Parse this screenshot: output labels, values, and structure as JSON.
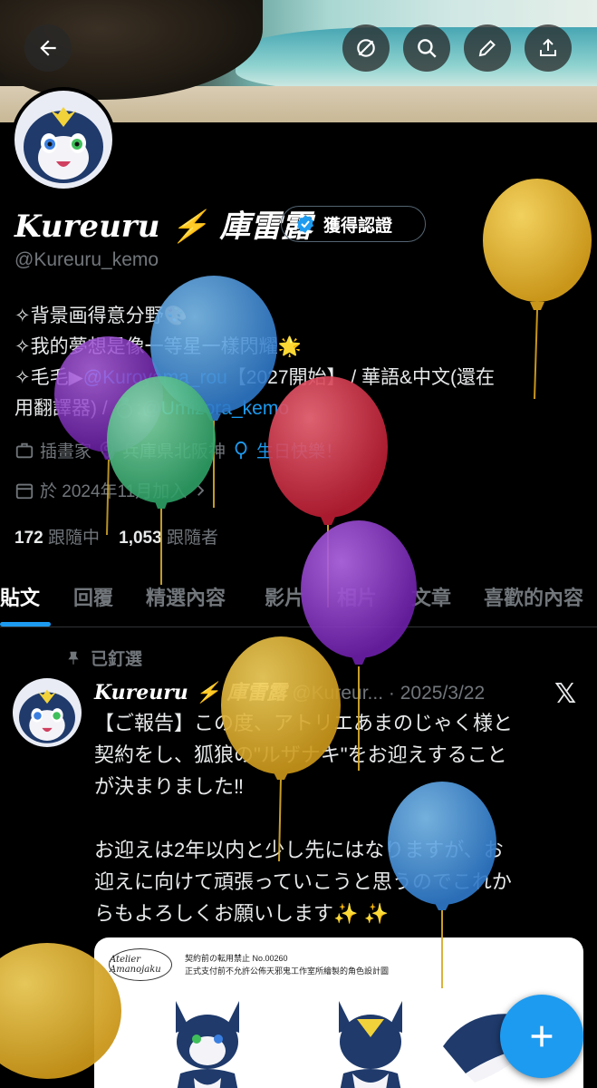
{
  "header": {
    "back_icon": "arrow-left-icon",
    "action_icons": [
      "eye-slash-icon",
      "search-icon",
      "pencil-icon",
      "share-icon"
    ]
  },
  "profile": {
    "display_name": "Kureuru ⚡ 庫雷露",
    "verified_label": "獲得認證",
    "handle": "@Kureuru_kemo",
    "bio_line1": "✧背景画得意分野🎨",
    "bio_line2": "✧我的夢想是像一等星一樣閃耀🌟",
    "bio_line3_prefix": "✧毛毛▶",
    "bio_link1": "@Kuroyama_rou",
    "bio_line3_mid": "【2027開始】 / 華語&中文(還在",
    "bio_line4_prefix": "用翻譯器) / 💍:",
    "bio_link2": "@Umizora_kemo",
    "job": "插畫家",
    "location": "兵庫県北阪神",
    "birthday": "生日快樂！",
    "joined": "於 2024年11月加入"
  },
  "stats": {
    "following_count": "172",
    "following_label": "跟隨中",
    "followers_count": "1,053",
    "followers_label": "跟隨者"
  },
  "tabs": [
    "貼文",
    "回覆",
    "精選內容",
    "影片",
    "相片",
    "文章",
    "喜歡的內容"
  ],
  "post": {
    "pinned_label": "已釘選",
    "author": "Kureuru ⚡ 庫雷露",
    "handle_trunc": "@Kureur...",
    "date": "· 2025/3/22",
    "text_line1": "【ご報告】この度、アトリエあまのじゃく様と",
    "text_line2": "契約をし、狐狼の\"ルザナキ\"をお迎えすること",
    "text_line3": "が決まりました‼︎",
    "text_line4": "お迎えは2年以内と少し先にはなりますが、お",
    "text_line5": "迎えに向けて頑張っていこうと思うのでこれか",
    "text_line6": "らもよろしくお願いします✨ ✨",
    "sheet_logo": "Atelier Amanojaku",
    "sheet_title": "契約前の転用禁止 No.00260",
    "sheet_subtitle": "正式支付前不允許公佈天邪鬼工作室所繪製的角色設計圖"
  },
  "colors": {
    "accent": "#1d9bf0",
    "muted": "#71767b",
    "balloon_yellow": "#d9ac2b",
    "balloon_blue": "#3f8fd6",
    "balloon_purple": "#8a2fc9",
    "balloon_green": "#3fbf7a",
    "balloon_red": "#d8283f"
  }
}
